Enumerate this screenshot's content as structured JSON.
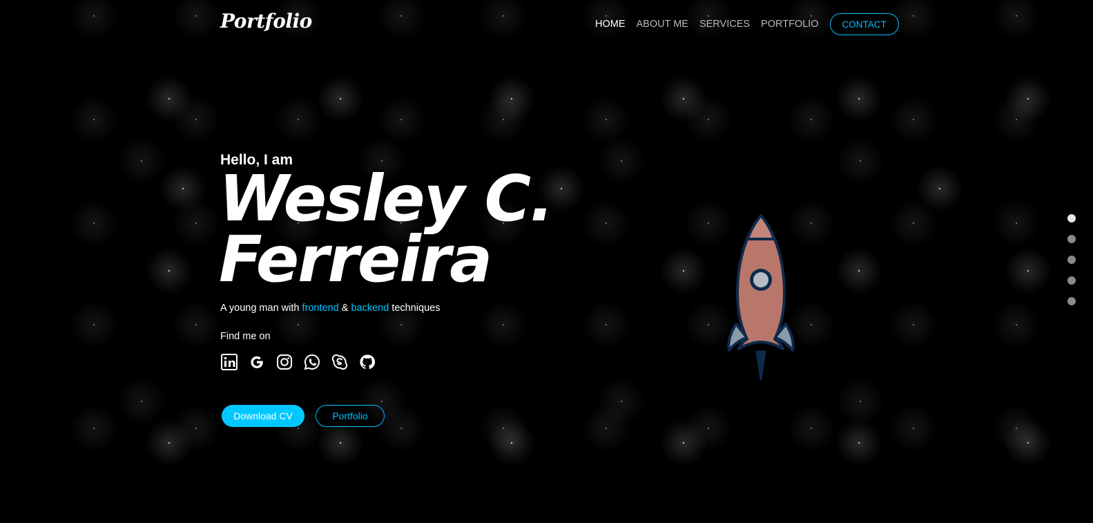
{
  "header": {
    "logo": "Portfolio",
    "nav": [
      {
        "label": "HOME",
        "active": true
      },
      {
        "label": "ABOUT ME",
        "active": false
      },
      {
        "label": "SERVICES",
        "active": false
      },
      {
        "label": "PORTFOLIO",
        "active": false
      }
    ],
    "contact_label": "CONTACT"
  },
  "hero": {
    "greeting": "Hello, I am",
    "name_line1": "Wesley C.",
    "name_line2": "Ferreira",
    "tagline": {
      "prefix": "A young man with",
      "highlight1": "frontend",
      "joiner": "&",
      "highlight2": "backend",
      "suffix": "techniques"
    },
    "find_me": "Find me on",
    "socials": [
      "linkedin-icon",
      "google-icon",
      "instagram-icon",
      "whatsapp-icon",
      "skype-icon",
      "github-icon"
    ],
    "download_cv_label": "Download CV",
    "portfolio_label": "Portfolio"
  },
  "section_dots": {
    "count": 5,
    "active_index": 0
  },
  "colors": {
    "accent": "#00c2ff",
    "background": "#000000",
    "rocket_body": "#b8776a",
    "rocket_outline": "#0f2a4a"
  }
}
